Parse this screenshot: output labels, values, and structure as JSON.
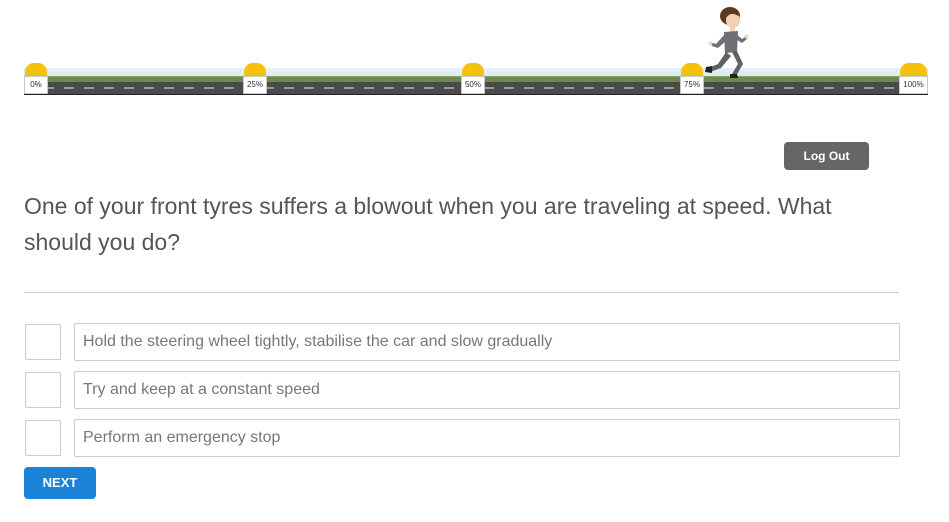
{
  "progress": {
    "markers": [
      "0%",
      "25%",
      "50%",
      "75%",
      "100%"
    ],
    "current_percent": 75
  },
  "header": {
    "logout_label": "Log Out"
  },
  "question": {
    "text": "One of your front tyres suffers a blowout when you are traveling at speed. What should you do?"
  },
  "options": [
    {
      "label": "Hold the steering wheel tightly, stabilise the car and slow gradually",
      "checked": false
    },
    {
      "label": "Try and keep at a constant speed",
      "checked": false
    },
    {
      "label": "Perform an emergency stop",
      "checked": false
    }
  ],
  "footer": {
    "next_label": "NEXT"
  },
  "colors": {
    "accent": "#1a82d8",
    "logout": "#666666",
    "marker": "#f4c20d"
  }
}
